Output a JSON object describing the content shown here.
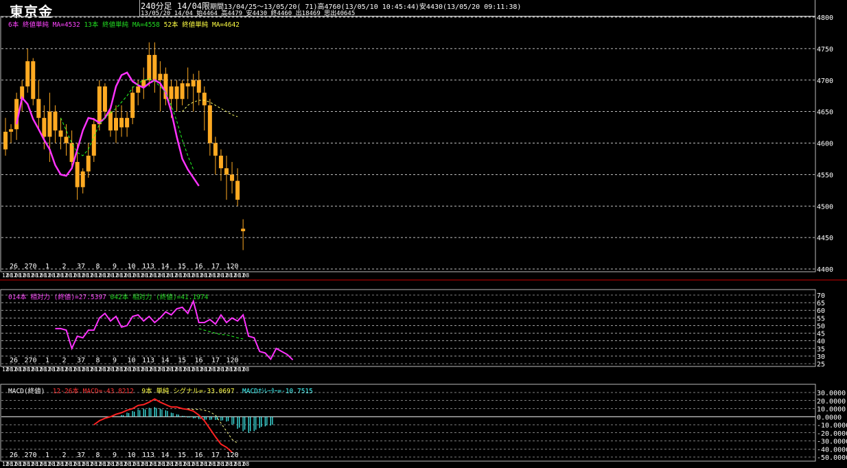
{
  "header": {
    "title": "東京金",
    "period_label": "240分足 14/04限",
    "info1": "期間13/04/25～13/05/20( 71)高4760(13/05/10 10:45:44)安4430(13/05/20 09:11:38)",
    "info2": "13/05/20 14/04 始4464 高4479 安4430 終4460 出18469 思出40645"
  },
  "panels": {
    "price": {
      "legend": [
        {
          "text": "6本 終値単純 MA=4532",
          "color": "#ff44ff"
        },
        {
          "text": "13本 終値単純 MA=4558",
          "color": "#22dd22"
        },
        {
          "text": "52本 終値単純 MA=4642",
          "color": "#ffff44"
        }
      ]
    },
    "rsi": {
      "legend": [
        {
          "text": "014本 相対力 (終値)=27.5397",
          "color": "#ff44ff"
        },
        {
          "text": "042本 相対力 (終値)=41.1974",
          "color": "#22dd22"
        }
      ]
    },
    "macd": {
      "legend": [
        {
          "text": "MACD(終値)",
          "color": "#ffffff"
        },
        {
          "text": "12-26本 MACD=-43.8212",
          "color": "#ff3333"
        },
        {
          "text": "9本 単純 シグナル=-33.0697",
          "color": "#ffff44"
        },
        {
          "text": "MACDｵｼﾚｰﾀｰ=-10.7515",
          "color": "#44ffff"
        }
      ]
    }
  },
  "colors": {
    "candle": "#ffaa22",
    "ma_short": "#ff33ff",
    "ma_mid": "#22ff22",
    "ma_long": "#ffff66",
    "macd": "#ff2222",
    "signal": "#ffff88",
    "osc": "#44ffff",
    "grid": "#ffffff",
    "separator": "#cc0000"
  },
  "chart_data": [
    {
      "type": "candlestick",
      "title": "東京金 240分足 14/04限",
      "ylim": [
        4400,
        4800
      ],
      "yticks": [
        4400,
        4450,
        4500,
        4550,
        4600,
        4650,
        4700,
        4750,
        4800
      ],
      "x_day_labels": [
        "26",
        "270",
        "1",
        "2",
        "37",
        "8",
        "9",
        "10",
        "113",
        "14",
        "15",
        "16",
        "17",
        "120"
      ],
      "x_time_labels": [
        "12",
        "08",
        "12",
        "08",
        "12",
        "08",
        "12",
        "08",
        "12",
        "08",
        "12",
        "08",
        "12",
        "08",
        "12",
        "08",
        "12",
        "08",
        "12",
        "08",
        "12",
        "08",
        "12",
        "08",
        "12",
        "08",
        "12",
        "08",
        "12",
        "08",
        "12",
        "08",
        "12",
        "08",
        "12",
        "08",
        "12",
        "08",
        "12",
        "08",
        "12",
        "08",
        "12",
        "08",
        "12",
        "08",
        "12",
        "08",
        "12",
        "08",
        "12",
        "08",
        "12",
        "08",
        "12",
        "08",
        "12",
        "08"
      ],
      "series": [
        {
          "name": "price",
          "values": [
            [
              4590,
              4640,
              4580,
              4618
            ],
            [
              4618,
              4630,
              4600,
              4622
            ],
            [
              4622,
              4680,
              4605,
              4670
            ],
            [
              4670,
              4700,
              4650,
              4690
            ],
            [
              4690,
              4750,
              4680,
              4730
            ],
            [
              4730,
              4735,
              4660,
              4670
            ],
            [
              4670,
              4700,
              4620,
              4640
            ],
            [
              4640,
              4660,
              4590,
              4610
            ],
            [
              4610,
              4680,
              4570,
              4650
            ],
            [
              4650,
              4660,
              4600,
              4620
            ],
            [
              4620,
              4640,
              4590,
              4610
            ],
            [
              4610,
              4630,
              4580,
              4600
            ],
            [
              4600,
              4620,
              4560,
              4570
            ],
            [
              4570,
              4600,
              4510,
              4530
            ],
            [
              4530,
              4560,
              4520,
              4555
            ],
            [
              4555,
              4600,
              4545,
              4580
            ],
            [
              4580,
              4640,
              4570,
              4630
            ],
            [
              4630,
              4700,
              4620,
              4690
            ],
            [
              4690,
              4695,
              4640,
              4650
            ],
            [
              4650,
              4660,
              4610,
              4620
            ],
            [
              4620,
              4660,
              4600,
              4640
            ],
            [
              4640,
              4660,
              4610,
              4625
            ],
            [
              4625,
              4650,
              4610,
              4640
            ],
            [
              4640,
              4690,
              4630,
              4680
            ],
            [
              4680,
              4700,
              4660,
              4690
            ],
            [
              4690,
              4720,
              4670,
              4700
            ],
            [
              4700,
              4760,
              4690,
              4740
            ],
            [
              4740,
              4760,
              4680,
              4700
            ],
            [
              4700,
              4730,
              4650,
              4710
            ],
            [
              4710,
              4720,
              4660,
              4670
            ],
            [
              4670,
              4700,
              4640,
              4690
            ],
            [
              4690,
              4700,
              4650,
              4670
            ],
            [
              4670,
              4700,
              4660,
              4695
            ],
            [
              4695,
              4720,
              4670,
              4690
            ],
            [
              4690,
              4710,
              4650,
              4700
            ],
            [
              4700,
              4715,
              4660,
              4680
            ],
            [
              4680,
              4690,
              4620,
              4660
            ],
            [
              4660,
              4670,
              4580,
              4600
            ],
            [
              4600,
              4610,
              4550,
              4580
            ],
            [
              4580,
              4590,
              4540,
              4560
            ],
            [
              4560,
              4580,
              4510,
              4550
            ],
            [
              4550,
              4570,
              4520,
              4540
            ],
            [
              4540,
              4560,
              4500,
              4510
            ],
            [
              4464,
              4479,
              4430,
              4460
            ]
          ]
        },
        {
          "name": "6本 終値単純 MA",
          "values": [
            4630,
            4672,
            4662,
            4638,
            4622,
            4605,
            4590,
            4565,
            4550,
            4548,
            4560,
            4590,
            4620,
            4640,
            4638,
            4632,
            4640,
            4655,
            4690,
            4708,
            4712,
            4698,
            4692,
            4688,
            4695,
            4700,
            4695,
            4680,
            4650,
            4610,
            4575,
            4558,
            4545,
            4532
          ]
        },
        {
          "name": "13本 終値単純 MA",
          "values": [
            4640,
            4620,
            4600,
            4585,
            4580,
            4590,
            4610,
            4630,
            4640,
            4648,
            4655,
            4665,
            4675,
            4688,
            4695,
            4700,
            4702,
            4698,
            4690,
            4680,
            4660,
            4635,
            4605,
            4580,
            4558
          ]
        },
        {
          "name": "52本 終値単純 MA",
          "values": [
            4650,
            4660,
            4665,
            4668,
            4668,
            4665,
            4660,
            4655,
            4650,
            4645,
            4642
          ]
        }
      ]
    },
    {
      "type": "line",
      "title": "相対力",
      "ylim": [
        25,
        70
      ],
      "yticks": [
        25,
        30,
        35,
        40,
        45,
        50,
        55,
        60,
        65,
        70
      ],
      "series": [
        {
          "name": "014本 相対力",
          "values": [
            48,
            48,
            47,
            35,
            43,
            42,
            47,
            47,
            55,
            58,
            53,
            56,
            49,
            50,
            56,
            57,
            53,
            56,
            52,
            55,
            59,
            57,
            61,
            62,
            58,
            66,
            52,
            52,
            54,
            51,
            57,
            52,
            55,
            53,
            57,
            43,
            42,
            33,
            32,
            28,
            35,
            33,
            31,
            27.5
          ]
        },
        {
          "name": "042本 相対力",
          "values": [
            48,
            47,
            46,
            45,
            44,
            44,
            43,
            42,
            41.2
          ]
        }
      ]
    },
    {
      "type": "line",
      "title": "MACD(終値)",
      "ylim": [
        -50,
        30
      ],
      "yticks": [
        30,
        20,
        10,
        0,
        -10,
        -20,
        -30,
        -40,
        -50
      ],
      "series": [
        {
          "name": "12-26本 MACD",
          "values": [
            -10,
            -5,
            -2,
            0,
            3,
            5,
            8,
            10,
            14,
            15,
            18,
            22,
            18,
            15,
            12,
            12,
            10,
            9,
            7,
            2,
            -5,
            -15,
            -25,
            -34,
            -38,
            -44
          ]
        },
        {
          "name": "9本 単純 シグナル",
          "values": [
            10,
            9,
            9,
            8,
            6,
            2,
            -8,
            -18,
            -28,
            -33
          ]
        },
        {
          "name": "MACDｵｼﾚｰﾀｰ",
          "values": [
            2,
            5,
            7,
            9,
            10,
            11,
            12,
            10,
            8,
            5,
            3,
            1,
            -1,
            -2,
            -3,
            -4,
            -4,
            -4,
            -5,
            -6,
            -10,
            -15,
            -18,
            -20,
            -18,
            -14,
            -12,
            -11
          ]
        }
      ]
    }
  ]
}
